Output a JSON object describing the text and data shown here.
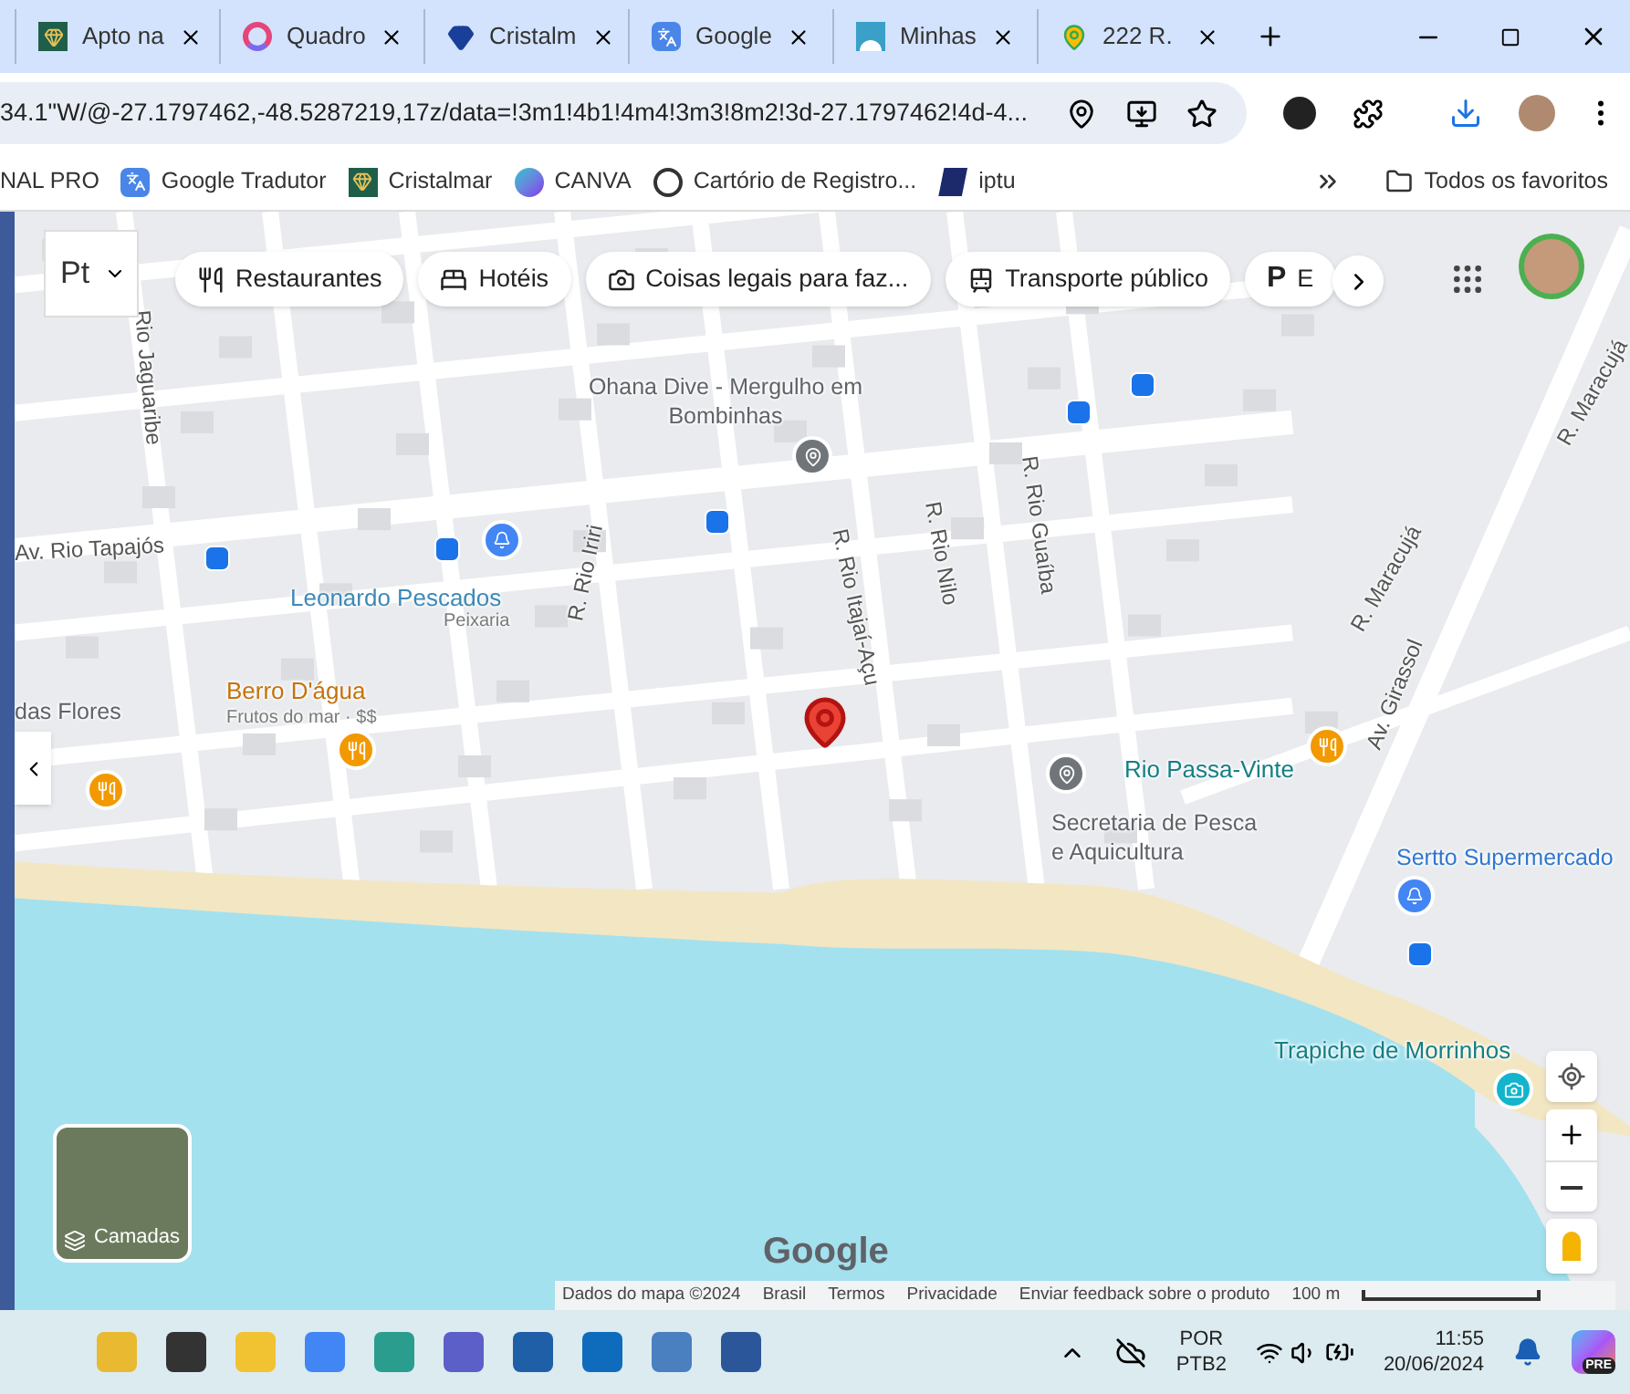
{
  "tabs": [
    {
      "title": "Apto na"
    },
    {
      "title": "Quadro"
    },
    {
      "title": "Cristalm"
    },
    {
      "title": "Google"
    },
    {
      "title": "Minhas"
    },
    {
      "title": "222 R."
    }
  ],
  "address_bar": {
    "url": "34.1\"W/@-27.1797462,-48.5287219,17z/data=!3m1!4b1!4m4!3m3!8m2!3d-27.1797462!4d-4..."
  },
  "bookmarks": [
    {
      "label": "NAL PRO"
    },
    {
      "label": "Google Tradutor"
    },
    {
      "label": "Cristalmar"
    },
    {
      "label": "CANVA"
    },
    {
      "label": "Cartório de Registro..."
    },
    {
      "label": "iptu"
    }
  ],
  "all_bookmarks": "Todos os favoritos",
  "map": {
    "input_mode": "Pt",
    "chips": [
      {
        "label": "Restaurantes"
      },
      {
        "label": "Hotéis"
      },
      {
        "label": "Coisas legais para faz..."
      },
      {
        "label": "Transporte público"
      },
      {
        "label": "E",
        "glyph": "P"
      }
    ],
    "labels": [
      {
        "text": "Rio Jaguaribe",
        "kind": "street"
      },
      {
        "text": "Ohana Dive - Mergulho em Bombinhas",
        "kind": "place"
      },
      {
        "text": "Av. Rio Tapajós",
        "kind": "street"
      },
      {
        "text": "Leonardo Pescados",
        "kind": "shop"
      },
      {
        "text": "Peixaria",
        "kind": "subtitle"
      },
      {
        "text": "R. Rio Iriri",
        "kind": "street"
      },
      {
        "text": "R. Rio Itajaí-Açu",
        "kind": "street"
      },
      {
        "text": "R. Rio Nilo",
        "kind": "street"
      },
      {
        "text": "R. Rio Guaíba",
        "kind": "street"
      },
      {
        "text": "R. Maracujá",
        "kind": "street"
      },
      {
        "text": "Av. Girassol",
        "kind": "street"
      },
      {
        "text": "R. Maracujá",
        "kind": "street"
      },
      {
        "text": "das Flores",
        "kind": "place"
      },
      {
        "text": "Berro D'água",
        "kind": "food"
      },
      {
        "text": "Frutos do mar · $$",
        "kind": "subtitle"
      },
      {
        "text": "Rio Passa-Vinte",
        "kind": "landmark"
      },
      {
        "text": "Secretaria de Pesca e Aquicultura",
        "kind": "place"
      },
      {
        "text": "Sertto Supermercado",
        "kind": "store"
      },
      {
        "text": "Trapiche de Morrinhos",
        "kind": "landmark"
      }
    ],
    "layers_label": "Camadas",
    "logo": "Google",
    "footer": [
      "Dados do mapa ©2024",
      "Brasil",
      "Termos",
      "Privacidade",
      "Enviar feedback sobre o produto"
    ],
    "scale": "100 m"
  },
  "taskbar": {
    "language": "POR",
    "layout": "PTB2",
    "time": "11:55",
    "date": "20/06/2024",
    "badge": "PRE"
  }
}
